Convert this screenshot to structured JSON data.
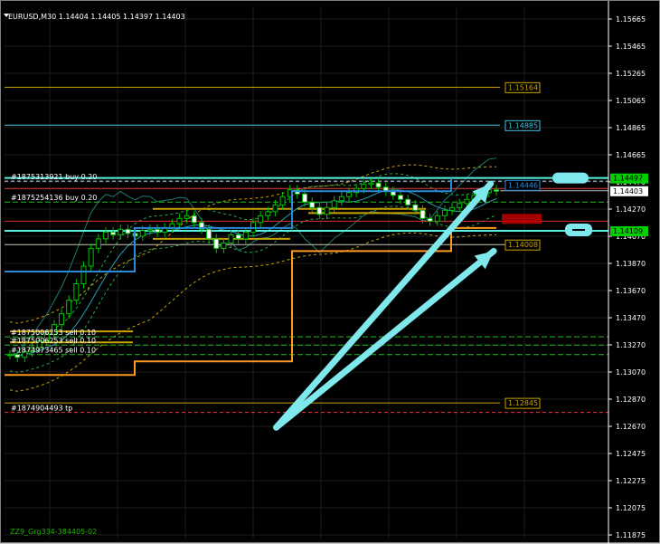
{
  "chart_title": "EURUSD,M30  1.14404 1.14405 1.14397 1.14403",
  "footer_text": "ZZ9_Grg334-384405-02",
  "colors": {
    "background": "#000000",
    "grid": "#1b1b1b",
    "axis_text": "#ffffff",
    "bull": "#00c000",
    "gold": "#c8a200",
    "cyan": "#42c6e0",
    "blue": "#2a8ad8",
    "orange": "#ff9a1e",
    "arrow": "#7fe8ec",
    "red": "#ff3030"
  },
  "chart_data": {
    "type": "candlestick",
    "symbol": "EURUSD",
    "timeframe": "M30",
    "ylim": [
      1.11875,
      1.15765
    ],
    "y_ticks": [
      "1.15665",
      "1.15465",
      "1.15265",
      "1.15065",
      "1.14865",
      "1.14665",
      "1.14470",
      "1.14270",
      "1.14070",
      "1.13870",
      "1.13670",
      "1.13470",
      "1.13270",
      "1.13070",
      "1.12870",
      "1.12670",
      "1.12475",
      "1.12275",
      "1.12075",
      "1.11875"
    ],
    "close_series": [
      1.132,
      1.1318,
      1.1322,
      1.1325,
      1.133,
      1.1335,
      1.1342,
      1.135,
      1.136,
      1.1372,
      1.1385,
      1.1398,
      1.1405,
      1.141,
      1.1408,
      1.1412,
      1.1409,
      1.1407,
      1.1411,
      1.1412,
      1.141,
      1.1413,
      1.1416,
      1.142,
      1.1422,
      1.1417,
      1.1412,
      1.1405,
      1.1398,
      1.1402,
      1.1408,
      1.1405,
      1.141,
      1.1417,
      1.1422,
      1.1425,
      1.143,
      1.1436,
      1.1441,
      1.1438,
      1.1432,
      1.1428,
      1.1423,
      1.1428,
      1.1433,
      1.1436,
      1.1439,
      1.1442,
      1.1445,
      1.1446,
      1.1443,
      1.144,
      1.1437,
      1.1434,
      1.143,
      1.1426,
      1.142,
      1.1418,
      1.1422,
      1.1426,
      1.1428,
      1.1431,
      1.1434,
      1.1437,
      1.1439,
      1.1441,
      1.144
    ],
    "current_price": "1.14403",
    "price_tags": [
      {
        "label": "1.15164",
        "value": 1.15164,
        "color": "#c8a200"
      },
      {
        "label": "1.14885",
        "value": 1.14885,
        "color": "#42c6e0"
      },
      {
        "label": "1.14446",
        "value": 1.14446,
        "color": "#2a8ad8"
      },
      {
        "label": "1.14008",
        "value": 1.14008,
        "color": "#c8a200"
      },
      {
        "label": "1.12845",
        "value": 1.12845,
        "color": "#c8a200"
      }
    ],
    "axis_markers": [
      {
        "label": "1.14497",
        "value": 1.14497,
        "bg": "#00d000",
        "fg": "#000000"
      },
      {
        "label": "1.14403",
        "value": 1.14403,
        "bg": "#ffffff",
        "fg": "#000000"
      },
      {
        "label": "1.14109",
        "value": 1.14109,
        "bg": "#00d000",
        "fg": "#000000"
      }
    ],
    "order_labels": [
      {
        "text": "#1875313921 buy 0.20",
        "value": 1.14474
      },
      {
        "text": "#1875254136 buy 0.20",
        "value": 1.14322
      },
      {
        "text": "#1875006253 sell 0.10",
        "value": 1.1333
      },
      {
        "text": "#1875006253 sell 0.10",
        "value": 1.1327
      },
      {
        "text": "#1874973465 sell 0.10",
        "value": 1.132
      },
      {
        "text": "#1874904493 tp",
        "value": 1.12775
      }
    ],
    "arrows": [
      {
        "from": [
          0.45,
          1.12665
        ],
        "to": [
          0.805,
          1.14455
        ]
      },
      {
        "from": [
          0.45,
          1.12665
        ],
        "to": [
          0.81,
          1.1396
        ]
      }
    ]
  }
}
